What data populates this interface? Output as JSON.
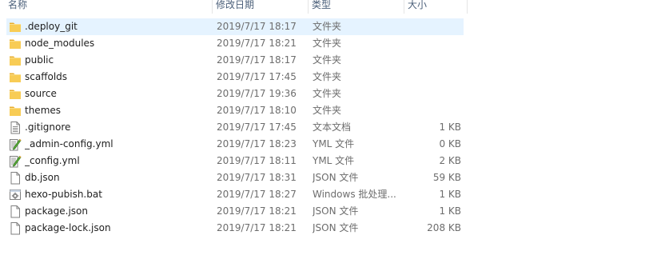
{
  "columns": {
    "name": "名称",
    "date": "修改日期",
    "type": "类型",
    "size": "大小"
  },
  "files": [
    {
      "name": ".deploy_git",
      "date": "2019/7/17 18:17",
      "type": "文件夹",
      "size": "",
      "icon": "folder-icon",
      "selected": true
    },
    {
      "name": "node_modules",
      "date": "2019/7/17 18:21",
      "type": "文件夹",
      "size": "",
      "icon": "folder-icon"
    },
    {
      "name": "public",
      "date": "2019/7/17 18:17",
      "type": "文件夹",
      "size": "",
      "icon": "folder-icon"
    },
    {
      "name": "scaffolds",
      "date": "2019/7/17 17:45",
      "type": "文件夹",
      "size": "",
      "icon": "folder-icon"
    },
    {
      "name": "source",
      "date": "2019/7/17 19:36",
      "type": "文件夹",
      "size": "",
      "icon": "folder-icon"
    },
    {
      "name": "themes",
      "date": "2019/7/17 18:10",
      "type": "文件夹",
      "size": "",
      "icon": "folder-icon"
    },
    {
      "name": ".gitignore",
      "date": "2019/7/17 17:45",
      "type": "文本文档",
      "size": "1 KB",
      "icon": "text-document-icon"
    },
    {
      "name": "_admin-config.yml",
      "date": "2019/7/17 18:23",
      "type": "YML 文件",
      "size": "0 KB",
      "icon": "yml-file-icon"
    },
    {
      "name": "_config.yml",
      "date": "2019/7/17 18:11",
      "type": "YML 文件",
      "size": "2 KB",
      "icon": "yml-file-icon"
    },
    {
      "name": "db.json",
      "date": "2019/7/17 18:31",
      "type": "JSON 文件",
      "size": "59 KB",
      "icon": "blank-file-icon"
    },
    {
      "name": "hexo-pubish.bat",
      "date": "2019/7/17 18:27",
      "type": "Windows 批处理...",
      "size": "1 KB",
      "icon": "batch-file-icon"
    },
    {
      "name": "package.json",
      "date": "2019/7/17 18:21",
      "type": "JSON 文件",
      "size": "1 KB",
      "icon": "blank-file-icon"
    },
    {
      "name": "package-lock.json",
      "date": "2019/7/17 18:21",
      "type": "JSON 文件",
      "size": "208 KB",
      "icon": "blank-file-icon"
    }
  ],
  "colors": {
    "selection": "#e5f3ff",
    "folder": "#f5c342",
    "header_text": "#4c607a",
    "meta_text": "#6d6d6d"
  }
}
